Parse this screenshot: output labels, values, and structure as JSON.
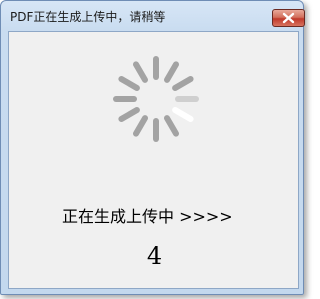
{
  "window": {
    "title": "PDF正在生成上传中，请稍等"
  },
  "status": {
    "message": "正在生成上传中 >>>>",
    "count": "4"
  },
  "spinner": {
    "icon": "loading-spinner-icon",
    "spoke_color": "#a3a3a3",
    "highlight_color": "#ffffff"
  },
  "colors": {
    "titlebar": "#c9dcf0",
    "client_background": "#f0f0f0",
    "close_button": "#c0392b"
  }
}
